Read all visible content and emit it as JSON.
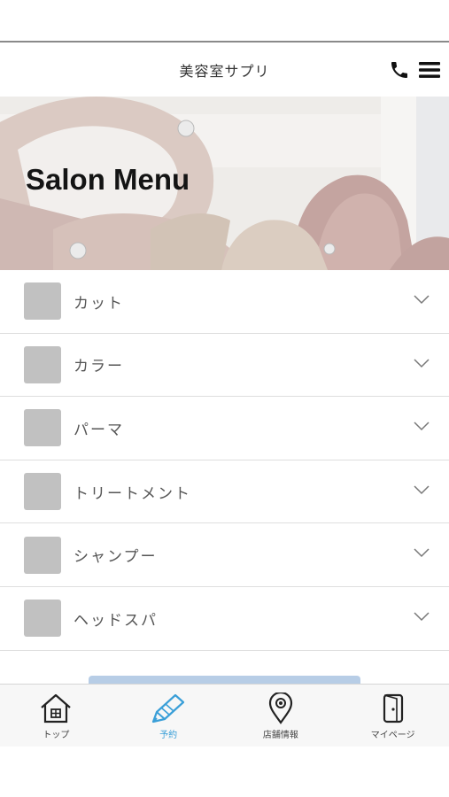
{
  "header": {
    "title": "美容室サプリ"
  },
  "hero": {
    "title": "Salon Menu"
  },
  "menu": {
    "items": [
      {
        "label": "カット"
      },
      {
        "label": "カラー"
      },
      {
        "label": "パーマ"
      },
      {
        "label": "トリートメント"
      },
      {
        "label": "シャンプー"
      },
      {
        "label": "ヘッドスパ"
      }
    ]
  },
  "tabbar": {
    "tabs": [
      {
        "label": "トップ",
        "icon": "home-icon"
      },
      {
        "label": "予約",
        "icon": "pencil-icon"
      },
      {
        "label": "店舗情報",
        "icon": "map-pin-icon"
      },
      {
        "label": "マイページ",
        "icon": "door-icon"
      }
    ],
    "active_index": 1
  },
  "colors": {
    "accent": "#3a9fd8",
    "thumb": "#c1c1c1",
    "reserve_button": "#b7cde6"
  }
}
